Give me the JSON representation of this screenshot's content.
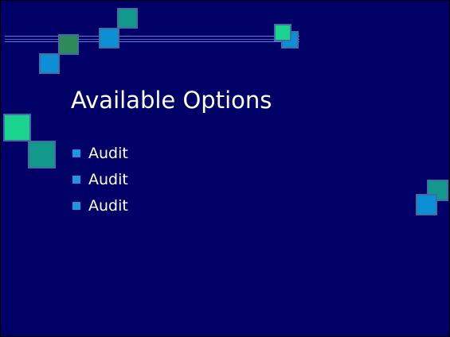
{
  "slide": {
    "title": "Available Options",
    "bullets": [
      {
        "text": "Audit"
      },
      {
        "text": "Audit"
      },
      {
        "text": "Audit"
      }
    ]
  },
  "colors": {
    "background": "#000066",
    "text": "#ffffff",
    "bullet": "#1a97e0",
    "accent_teal": "#13998c",
    "accent_blue": "#0d8fd6",
    "accent_green": "#19d38e",
    "accent_dark_green": "#2e8b57",
    "line": "#5b7fd0"
  },
  "decorations": [
    "decorative-line",
    "decorative-square"
  ]
}
